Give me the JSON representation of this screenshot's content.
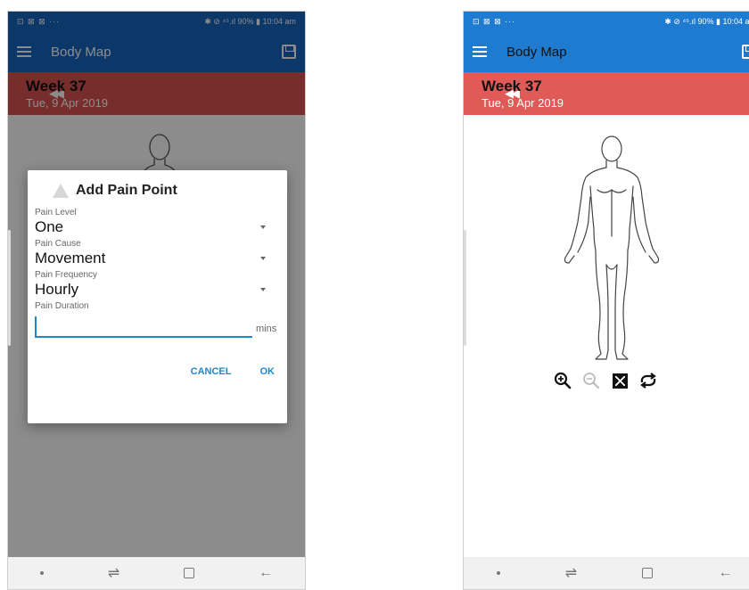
{
  "status_bar": {
    "left_icons": "⊡ ⊠ ⊠ ···",
    "right_text": "✱ ⊘ ⁴⁵.ıl 90% ▮ 10:04 am"
  },
  "app_bar": {
    "title": "Body Map"
  },
  "week": {
    "title": "Week 37",
    "date": "Tue, 9 Apr 2019"
  },
  "dialog": {
    "title": "Add Pain Point",
    "fields": [
      {
        "label": "Pain Level",
        "value": "One"
      },
      {
        "label": "Pain Cause",
        "value": "Movement"
      },
      {
        "label": "Pain Frequency",
        "value": "Hourly"
      }
    ],
    "duration": {
      "label": "Pain Duration",
      "value": "",
      "unit": "mins"
    },
    "cancel_label": "CANCEL",
    "ok_label": "OK"
  },
  "zoom_controls": [
    "zoom-in-icon",
    "zoom-out-icon",
    "fit-screen-icon",
    "rotate-icon"
  ],
  "colors": {
    "app_bar_blue": "#1565c0",
    "week_bar_red": "#d9534f",
    "accent": "#1e88c8",
    "nav_bar": "#f1f1f1"
  }
}
